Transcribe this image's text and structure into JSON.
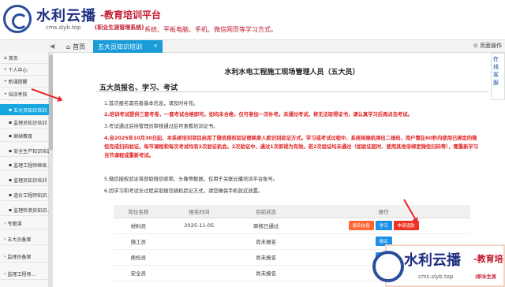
{
  "brand": {
    "title": "水利云播",
    "subtitle": "-教育培训平台",
    "tagline": "(职业生涯管理系统)",
    "desc": "系统、平板电脑、手机、微信网页等学习方式。",
    "domain": "cms.slyb.top"
  },
  "tabs": {
    "nav_left": "◀",
    "home_label": "首页",
    "active_label": "五大员知识培训",
    "close": "×",
    "page_control": "页面操作"
  },
  "sidebar": {
    "items": [
      {
        "label": "首页"
      },
      {
        "label": "个人中心"
      },
      {
        "label": "新课提醒"
      },
      {
        "label": "培训考核"
      },
      {
        "label": "五大员知识培训"
      },
      {
        "label": "监理员知识培训"
      },
      {
        "label": "继续教育"
      },
      {
        "label": "安全生产知识培训"
      },
      {
        "label": "监理工程师继续..."
      },
      {
        "label": "监理员知识培训"
      },
      {
        "label": "造价工程师知识..."
      },
      {
        "label": "监理检测员知识..."
      },
      {
        "label": "专题课"
      },
      {
        "label": "五大员备案"
      },
      {
        "label": "监理员备案"
      },
      {
        "label": "监理工程师..."
      }
    ]
  },
  "main": {
    "page_title": "水利水电工程施工现场管理人员（五大员）",
    "section_title": "五大员报名、学习、考试",
    "notices": [
      "1.首次报名需完善基本信息，请及时补充。",
      "2.培训考试提供三套考卷，一套考试合格即可。如均未合格，仅可参加一次补考。未通过考试，将无法取得证书，请认真学习后再点击考试。",
      "3.考试通过后待管理员审核通过后可查看培训证书。",
      "4.自2025年10月30日起，本系统培训项目启用了微信授权验证替换原人脸识别验证方式。学习或考试过程中，系统将随机弹出二维码，用户需在60秒内使用已绑定的微信完成扫码验证。每节课程和每次考试均有2次验证机会。2次验证中，通过1次即视为有效。若2次验证均未通过（如验证超时、使用其他非绑定微信扫码等），需重新学习当节课程或重新考试。",
      "5.微信授权验证将获取微信昵称、头像等数据，仅用于关联云播培训平台账号。",
      "6.因学习和考试全过程采取微信随机验证方式，请您确保手机就近放置。"
    ],
    "table": {
      "headers": [
        "岗位名称",
        "报名时间",
        "目前状态",
        "操作"
      ],
      "rows": [
        {
          "position": "材料员",
          "date": "2025-11-05",
          "status": "审核已通过",
          "actions": [
            "报名信息",
            "学习",
            "申请退款"
          ]
        },
        {
          "position": "施工员",
          "date": "",
          "status": "尚未报名",
          "actions": [
            "报名"
          ]
        },
        {
          "position": "质检员",
          "date": "",
          "status": "尚未报名",
          "actions": [
            "报名"
          ]
        },
        {
          "position": "安全员",
          "date": "",
          "status": "尚未报名",
          "actions": []
        }
      ]
    }
  },
  "right_panel": {
    "text": "在线客服"
  },
  "watermark": {
    "title": "水利云播",
    "subtitle": "-教育培",
    "domain": "cms.slyb.top",
    "tagline": "(职业生涯"
  }
}
